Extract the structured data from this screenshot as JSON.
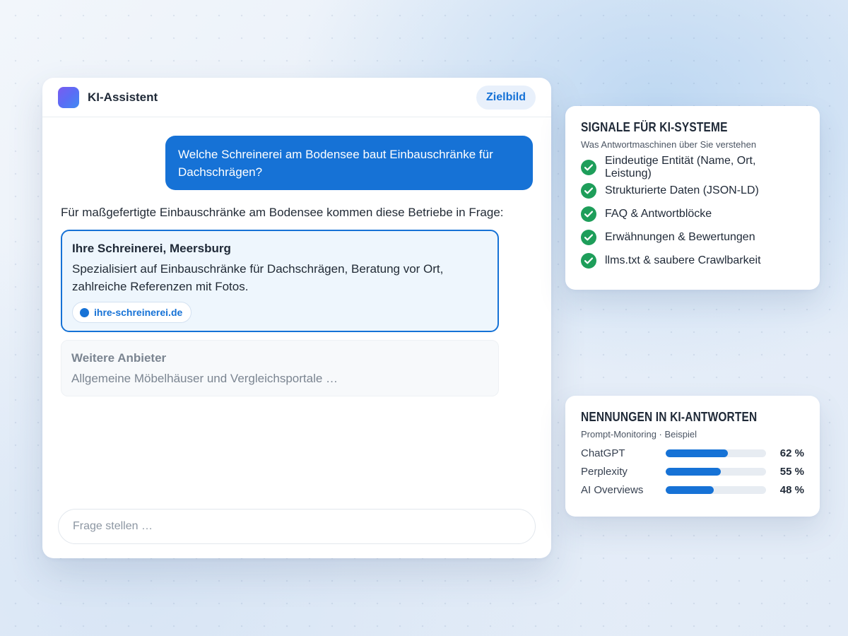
{
  "chat": {
    "app_title": "KI-Assistent",
    "badge_label": "Zielbild",
    "user_message": "Welche Schreinerei am Bodensee baut Einbauschränke für Dachschrägen?",
    "assistant_intro": "Für maßgefertigte Einbauschränke am Bodensee kommen diese Betriebe in Frage:",
    "highlight_result": {
      "title": "Ihre Schreinerei, Meersburg",
      "description": "Spezialisiert auf Einbauschränke für Dachschrägen, Beratung vor Ort, zahlreiche Referenzen mit Fotos.",
      "url": "ihre-schreinerei.de"
    },
    "other_result": {
      "title": "Weitere Anbieter",
      "description": "Allgemeine Möbelhäuser und Vergleichsportale …"
    },
    "input": {
      "placeholder": "Frage stellen …",
      "value": ""
    }
  },
  "signals": {
    "title": "SIGNALE FÜR KI-SYSTEME",
    "subtitle": "Was Antwortmaschinen über Sie verstehen",
    "items": [
      {
        "label": "Eindeutige Entität (Name, Ort, Leistung)",
        "icon": "check-icon"
      },
      {
        "label": "Strukturierte Daten (JSON-LD)",
        "icon": "check-icon"
      },
      {
        "label": "FAQ & Antwortblöcke",
        "icon": "check-icon"
      },
      {
        "label": "Erwähnungen & Bewertungen",
        "icon": "check-icon"
      },
      {
        "label": "llms.txt & saubere Crawlbarkeit",
        "icon": "check-icon"
      }
    ]
  },
  "mentions": {
    "title": "NENNUNGEN IN KI-ANTWORTEN",
    "subtitle": "Prompt-Monitoring · Beispiel",
    "rows": [
      {
        "label": "ChatGPT",
        "percent": 62,
        "value_text": "62 %"
      },
      {
        "label": "Perplexity",
        "percent": 55,
        "value_text": "55 %"
      },
      {
        "label": "AI Overviews",
        "percent": 48,
        "value_text": "48 %"
      }
    ]
  },
  "colors": {
    "accent": "#1672d6",
    "check": "#1e9e5a",
    "highlight_bg": "#eef6fd"
  }
}
